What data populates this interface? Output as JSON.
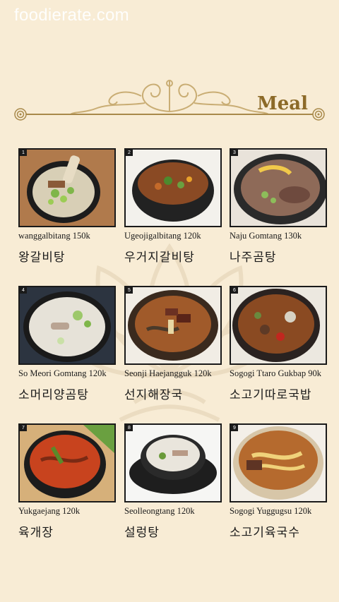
{
  "watermark": "foodierate.com",
  "section_title": "Meal",
  "items": [
    {
      "num": "1",
      "name": "wanggalbitang   150k",
      "korean": "왕갈비탕",
      "icon": "beef-rib-soup-photo"
    },
    {
      "num": "2",
      "name": "Ugeojigalbitang  120k",
      "korean": "우거지갈비탕",
      "icon": "cabbage-rib-stew-photo"
    },
    {
      "num": "3",
      "name": "Naju Gomtang    130k",
      "korean": "나주곰탕",
      "icon": "beef-bone-soup-photo"
    },
    {
      "num": "4",
      "name": "So Meori Gomtang 120k",
      "korean": "소머리양곰탕",
      "icon": "milky-broth-soup-photo"
    },
    {
      "num": "5",
      "name": "Seonji Haejangguk 120k",
      "korean": "선지해장국",
      "icon": "blood-sausage-soup-photo"
    },
    {
      "num": "6",
      "name": "Sogogi Ttaro Gukbap 90k",
      "korean": "소고기따로국밥",
      "icon": "spicy-beef-rice-soup-photo"
    },
    {
      "num": "7",
      "name": "Yukgaejang 120k",
      "korean": "육개장",
      "icon": "spicy-beef-soup-photo"
    },
    {
      "num": "8",
      "name": "Seolleongtang 120k",
      "korean": "설렁탕",
      "icon": "ox-bone-soup-photo"
    },
    {
      "num": "9",
      "name": "Sogogi Yuggugsu 120k",
      "korean": "소고기육국수",
      "icon": "beef-noodle-soup-photo"
    }
  ]
}
